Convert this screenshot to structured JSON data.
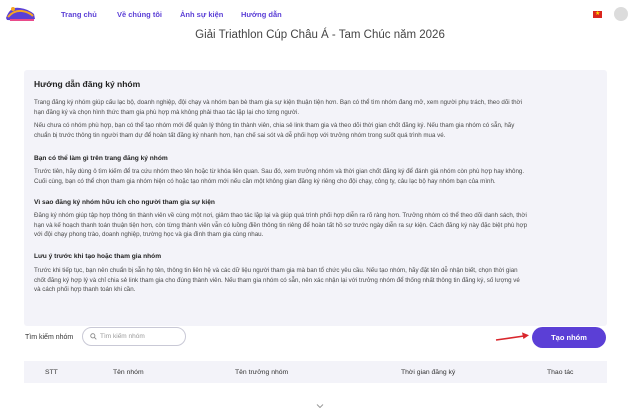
{
  "nav": {
    "logo_icon": "race-logo-icon",
    "items": [
      {
        "label": "Trang chủ"
      },
      {
        "label": "Về chúng tôi"
      },
      {
        "label": "Ảnh sự kiện"
      },
      {
        "label": "Hướng dẫn"
      }
    ],
    "language_flag": "vietnam-flag-icon",
    "avatar_icon": "user-avatar-icon"
  },
  "page": {
    "title": "Giải Triathlon Cúp Châu Á - Tam Chúc năm 2026"
  },
  "guide": {
    "title": "Hướng dẫn đăng ký nhóm",
    "p1": [
      "Trang đăng ký nhóm giúp cấu lạc bộ, doanh nghiệp, đội chạy và nhóm bạn bè tham gia sự kiện thuận tiện hơn. Bạn có thể tìm nhóm đang mở, xem người phụ trách, theo dõi thời",
      "hạn đăng ký và chọn hình thức tham gia phù hợp mà không phải thao tác lặp lại cho từng người."
    ],
    "p2": [
      "Nếu chưa có nhóm phù hợp, bạn có thể tạo nhóm mới để quản lý thông tin thành viên, chia sẻ link tham gia và theo dõi thời gian chốt đăng ký. Nếu tham gia nhóm có sẵn, hãy",
      "chuẩn bị trước thông tin người tham dự để hoàn tất đăng ký nhanh hơn, hạn chế sai sót và dễ phối hợp với trưởng nhóm trong suốt quá trình mua vé."
    ],
    "s1": "Bạn có thể làm gì trên trang đăng ký nhóm",
    "p3": [
      "Trước tiên, hãy dùng ô tìm kiếm để tra cứu nhóm theo tên hoặc từ khóa liên quan. Sau đó, xem trưởng nhóm và thời gian chốt đăng ký để đánh giá nhóm còn phù hợp hay không.",
      "Cuối cùng, bạn có thể chọn tham gia nhóm hiện có hoặc tạo nhóm mới nếu cần một không gian đăng ký riêng cho đội chạy, công ty, câu lạc bộ hay nhóm bạn của mình."
    ],
    "s2": "Vì sao đăng ký nhóm hữu ích cho người tham gia sự kiện",
    "p4": [
      "Đăng ký nhóm giúp tập hợp thông tin thành viên về cùng một nơi, giảm thao tác lặp lại và giúp quá trình phối hợp diễn ra rõ ràng hơn. Trưởng nhóm có thể theo dõi danh sách, thời",
      "hạn và kế hoạch thanh toán thuận tiện hơn, còn từng thành viên vẫn có luồng điền thông tin riêng để hoàn tất hồ sơ trước ngày diễn ra sự kiện. Cách đăng ký này đặc biệt phù hợp",
      "với đội chạy phong trào, doanh nghiệp, trường học và gia đình tham gia cùng nhau."
    ],
    "s3": "Lưu ý trước khi tạo hoặc tham gia nhóm",
    "p5": [
      "Trước khi tiếp tục, bạn nên chuẩn bị sẵn họ tên, thông tin liên hệ và các dữ liệu người tham gia mà ban tổ chức yêu cầu. Nếu tạo nhóm, hãy đặt tên dễ nhận biết, chọn thời gian",
      "chốt đăng ký hợp lý và chỉ chia sẻ link tham gia cho đúng thành viên. Nếu tham gia nhóm có sẵn, nên xác nhận lại với trưởng nhóm để thống nhất thông tin đăng ký, số lượng vé",
      "và cách phối hợp thanh toán khi cần."
    ]
  },
  "search": {
    "label": "Tìm kiếm nhóm",
    "placeholder": "Tìm kiếm nhóm",
    "value": "",
    "icon": "search-icon"
  },
  "create_button": {
    "label": "Tạo nhóm"
  },
  "table": {
    "columns": [
      "STT",
      "Tên nhóm",
      "Tên trưởng nhóm",
      "Thời gian đăng ký",
      "Thao tác"
    ],
    "rows": []
  },
  "colors": {
    "brand": "#5b3fd6",
    "guide_bg": "#f3f3f9",
    "arrow": "#d9262c"
  }
}
